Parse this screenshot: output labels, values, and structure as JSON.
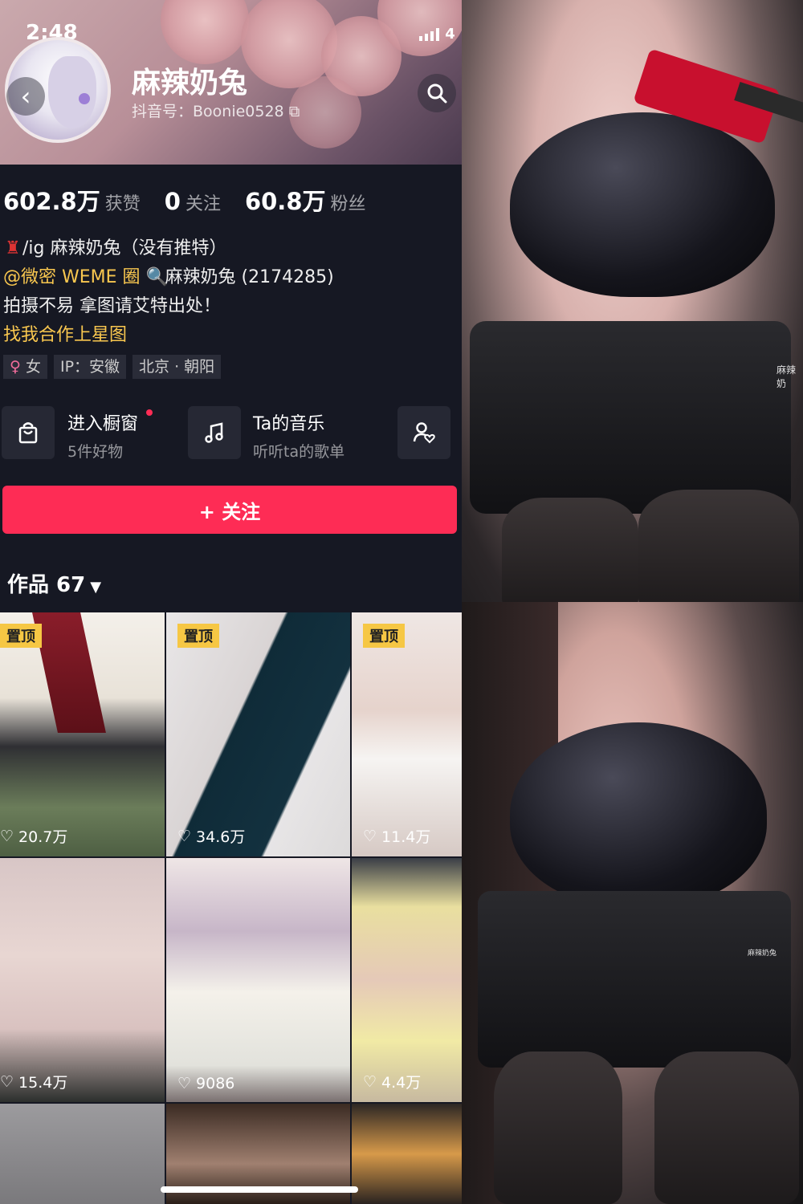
{
  "status_bar": {
    "time": "2:48",
    "battery": "4"
  },
  "profile": {
    "name": "麻辣奶兔",
    "douyin_id": "抖音号：Boonie0528"
  },
  "stats": [
    {
      "value": "602.8万",
      "label": "获赞"
    },
    {
      "value": "0",
      "label": "关注"
    },
    {
      "value": "60.8万",
      "label": "粉丝"
    }
  ],
  "bio": {
    "line1": "/ig 麻辣奶兔（没有推特）",
    "line2_mention": "@微密 WEME 圈",
    "line2_rest": "麻辣奶兔 (2174285)",
    "line3": "拍摄不易 拿图请艾特出处！",
    "line4": "找我合作上星图"
  },
  "tags": [
    "女",
    "IP：安徽",
    "北京 · 朝阳"
  ],
  "quick": {
    "shop_title": "进入橱窗",
    "shop_sub": "5件好物",
    "music_title": "Ta的音乐",
    "music_sub": "听听ta的歌单"
  },
  "follow_label": "+ 关注",
  "works_tab": "作品 67",
  "pin_label": "置顶",
  "videos": [
    {
      "likes": "20.7万",
      "pinned": true
    },
    {
      "likes": "34.6万",
      "pinned": true
    },
    {
      "likes": "11.4万",
      "pinned": true
    },
    {
      "likes": "15.4万",
      "pinned": false
    },
    {
      "likes": "9086",
      "pinned": false
    },
    {
      "likes": "4.4万",
      "pinned": false
    }
  ],
  "watermarks": {
    "top": "麻辣奶",
    "bottom": "麻辣奶兔"
  },
  "colors": {
    "accent": "#fe2c55",
    "mention": "#f9c74f",
    "background": "#161823"
  }
}
